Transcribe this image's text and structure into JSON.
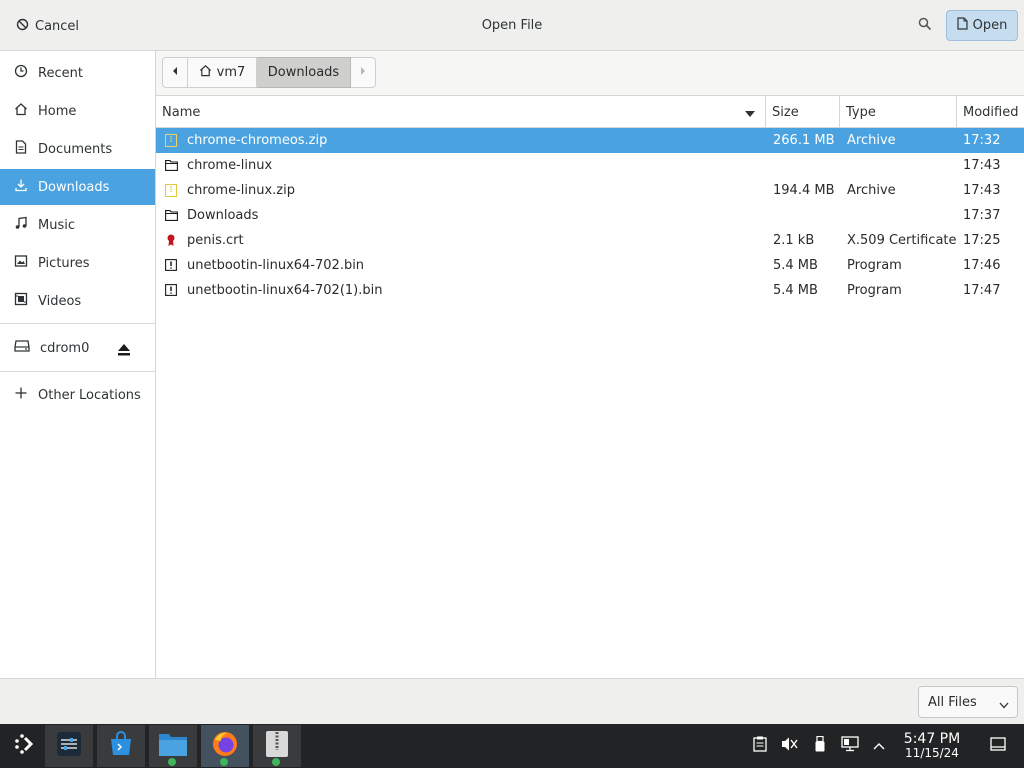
{
  "header": {
    "cancel_label": "Cancel",
    "title": "Open File",
    "open_label": "Open",
    "search_icon": "search-icon"
  },
  "sidebar": {
    "items": [
      {
        "id": "recent",
        "label": "Recent",
        "icon": "clock-icon"
      },
      {
        "id": "home",
        "label": "Home",
        "icon": "home-icon"
      },
      {
        "id": "documents",
        "label": "Documents",
        "icon": "document-icon"
      },
      {
        "id": "downloads",
        "label": "Downloads",
        "icon": "download-icon",
        "active": true
      },
      {
        "id": "music",
        "label": "Music",
        "icon": "music-icon"
      },
      {
        "id": "pictures",
        "label": "Pictures",
        "icon": "picture-icon"
      },
      {
        "id": "videos",
        "label": "Videos",
        "icon": "video-icon"
      }
    ],
    "devices": [
      {
        "id": "cdrom0",
        "label": "cdrom0",
        "icon": "drive-icon",
        "eject": true
      }
    ],
    "other": {
      "label": "Other Locations",
      "icon": "plus-icon"
    }
  },
  "pathbar": {
    "segments": [
      "vm7",
      "Downloads"
    ],
    "active": "Downloads"
  },
  "columns": {
    "name": "Name",
    "size": "Size",
    "type": "Type",
    "modified": "Modified"
  },
  "files": [
    {
      "name": "chrome-chromeos.zip",
      "size": "266.1 MB",
      "type": "Archive",
      "modified": "17:32",
      "icon": "archive-icon",
      "selected": true
    },
    {
      "name": "chrome-linux",
      "size": "",
      "type": "",
      "modified": "17:43",
      "icon": "folder-icon"
    },
    {
      "name": "chrome-linux.zip",
      "size": "194.4 MB",
      "type": "Archive",
      "modified": "17:43",
      "icon": "archive-icon"
    },
    {
      "name": "Downloads",
      "size": "",
      "type": "",
      "modified": "17:37",
      "icon": "folder-icon"
    },
    {
      "name": "penis.crt",
      "size": "2.1 kB",
      "type": "X.509 Certificate",
      "modified": "17:25",
      "icon": "certificate-icon"
    },
    {
      "name": "unetbootin-linux64-702.bin",
      "size": "5.4 MB",
      "type": "Program",
      "modified": "17:46",
      "icon": "executable-icon"
    },
    {
      "name": "unetbootin-linux64-702(1).bin",
      "size": "5.4 MB",
      "type": "Program",
      "modified": "17:47",
      "icon": "executable-icon"
    }
  ],
  "footer": {
    "filter_value": "All Files"
  },
  "taskbar": {
    "apps": [
      "app-launcher-icon",
      "settings-icon",
      "store-icon",
      "file-manager-icon",
      "firefox-icon",
      "archive-manager-icon"
    ],
    "tray": [
      "clipboard-icon",
      "volume-muted-icon",
      "usb-icon",
      "network-icon",
      "chevron-up-icon"
    ],
    "clock_time": "5:47 PM",
    "clock_date": "11/15/24"
  },
  "colors": {
    "accent": "#4aa3e0",
    "open_button": "#c6dcef",
    "taskbar": "#222324",
    "header": "#efefee"
  }
}
